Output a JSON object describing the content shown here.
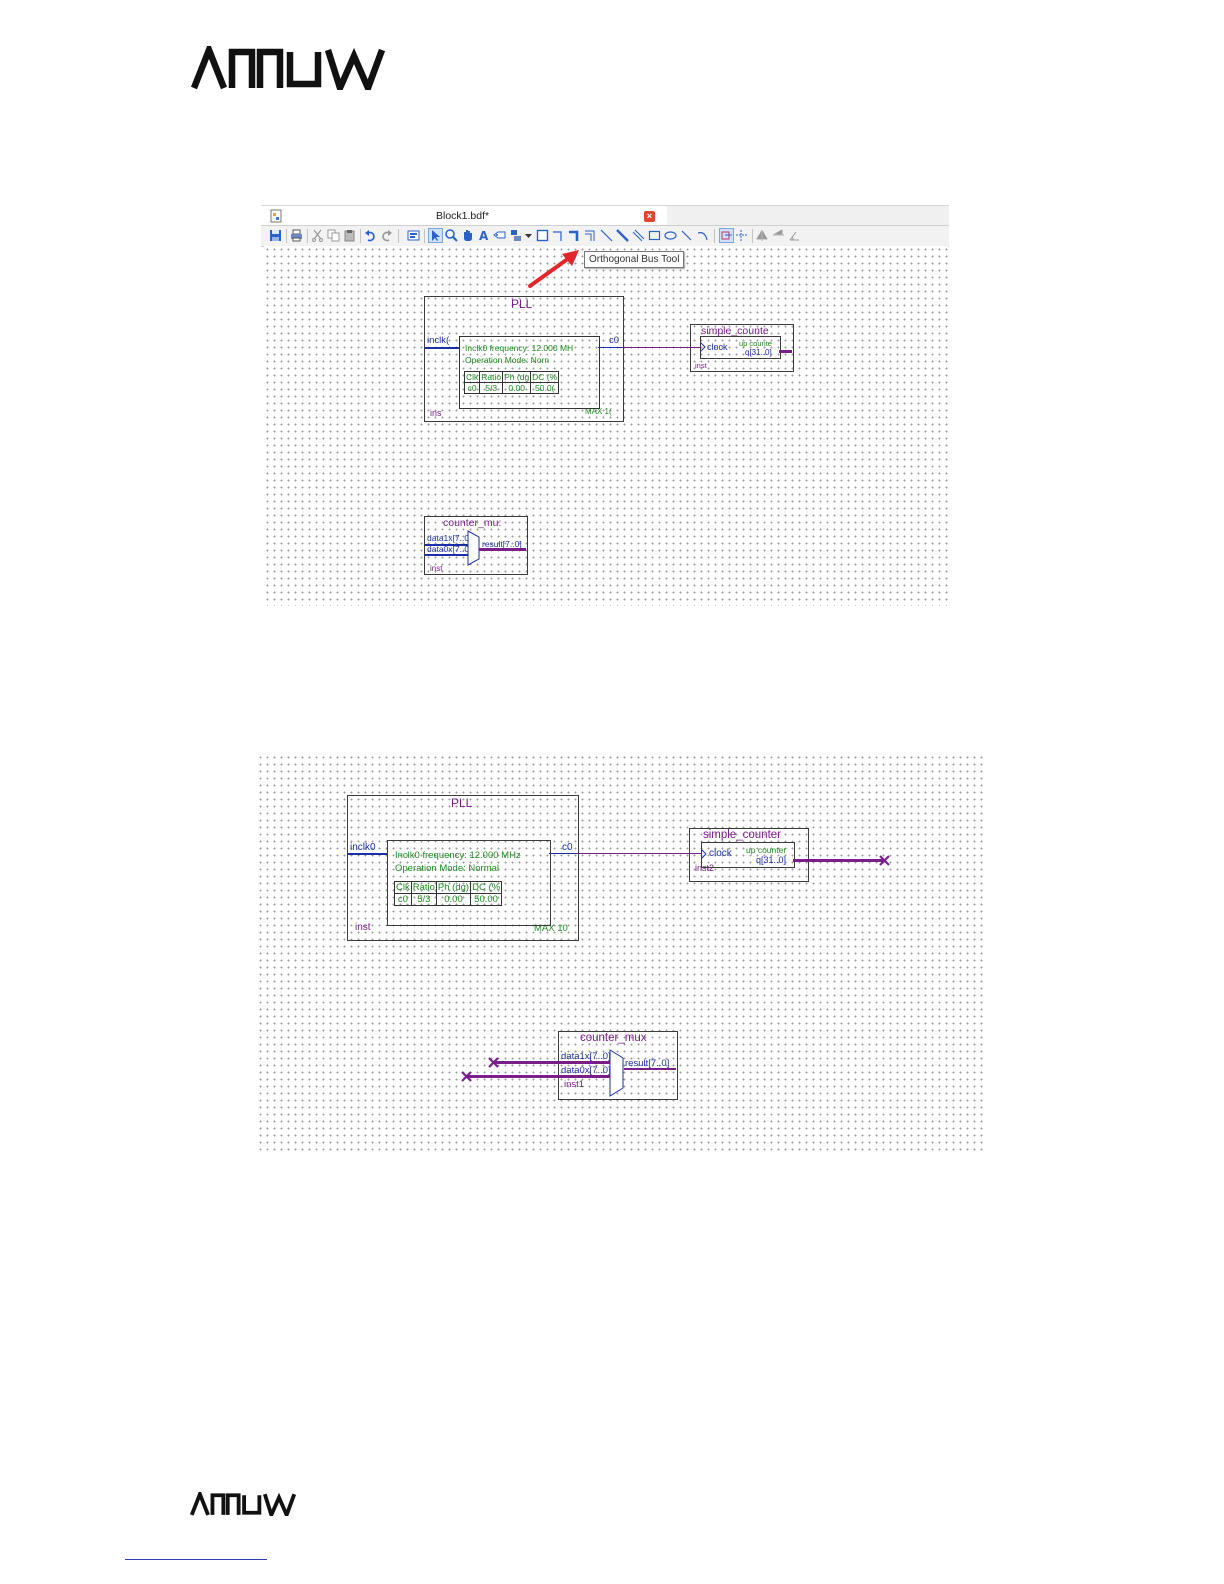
{
  "brand": {
    "logo_text": "ARROW"
  },
  "screenshot1": {
    "tab_title": "Block1.bdf*",
    "close_icon": "close-icon",
    "tooltip": "Orthogonal Bus Tool",
    "toolbar_icons": [
      "save-icon",
      "print-icon",
      "cut-icon",
      "copy-icon",
      "paste-icon",
      "undo-icon",
      "redo-icon",
      "symbol-icon",
      "select-icon",
      "zoom-icon",
      "hand-icon",
      "text-icon",
      "pin-icon",
      "symbol-tool-icon",
      "dropdown-icon",
      "block-tool-icon",
      "orthogonal-node-icon",
      "orthogonal-bus-icon",
      "orthogonal-conduit-icon",
      "diagonal-node-icon",
      "diagonal-bus-icon",
      "diagonal-conduit-icon",
      "rectangle-icon",
      "oval-icon",
      "line-icon",
      "arc-icon",
      "rubberband-icon",
      "partial-line-icon",
      "flip-horizontal-icon",
      "flip-vertical-icon",
      "rotate-icon"
    ],
    "pll": {
      "title": "PLL",
      "port_in": "inclk(",
      "port_out": "c0",
      "line1": "Inclk0 frequency: 12.000 MH",
      "line2": "Operation Mode: Norn",
      "headers": [
        "Clk",
        "Ratio",
        "Ph (dg",
        "DC (%"
      ],
      "row": [
        "c0",
        "5/3",
        "0.00",
        "50.0("
      ],
      "inst": "ins",
      "family": "MAX 1("
    },
    "counter": {
      "title": "simple_counte",
      "port_in": "clock",
      "label_up": "up counte",
      "port_out": "q[31..0]",
      "inst": "inst"
    },
    "mux": {
      "title": "counter_mu:",
      "port1": "data1x[7..0]",
      "port0": "data0x[7..0]",
      "result": "result[7..0]",
      "inst": "inst"
    }
  },
  "screenshot2": {
    "pll": {
      "title": "PLL",
      "port_in": "inclk0",
      "port_out": "c0",
      "line1": "Inclk0 frequency: 12.000 MHz",
      "line2": "Operation Mode: Normal",
      "headers": [
        "Clk",
        "Ratio",
        "Ph (dg)",
        "DC (%"
      ],
      "row": [
        "c0",
        "5/3",
        "0.00",
        "50.00"
      ],
      "inst": "inst",
      "family": "MAX 10"
    },
    "counter": {
      "title": "simple_counter",
      "port_in": "clock",
      "label_up": "up counter",
      "port_out": "q[31..0]",
      "inst": "inst2"
    },
    "mux": {
      "title": "counter_mux",
      "port1": "data1x[7..0]",
      "port0": "data0x[7..0]",
      "result": "result[7..0]",
      "inst": "inst1"
    },
    "bus_end_icon": "x-mark-icon"
  },
  "colors": {
    "symbol": "#7a1f8a",
    "port": "#1b2fa8",
    "param": "#1e8a1e",
    "arrow": "#e3262b"
  }
}
